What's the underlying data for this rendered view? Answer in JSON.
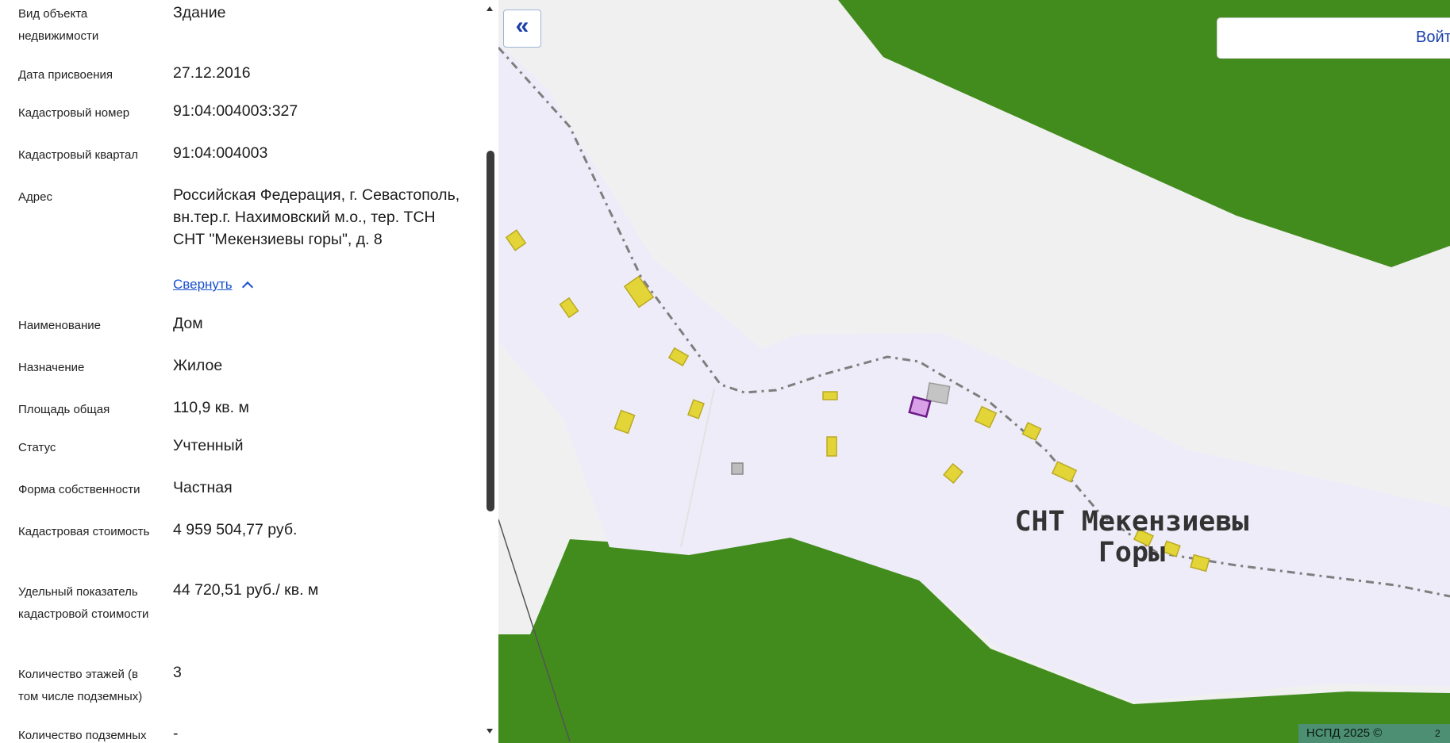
{
  "properties": [
    {
      "label": "Вид объекта недвижимости",
      "value": "Здание"
    },
    {
      "label": "Дата присвоения",
      "value": "27.12.2016"
    },
    {
      "label": "Кадастровый номер",
      "value": "91:04:004003:327"
    },
    {
      "label": "Кадастровый квартал",
      "value": "91:04:004003"
    },
    {
      "label": "Адрес",
      "value": "Российская Федерация, г. Севастополь, вн.тер.г. Нахимовский м.о., тер. ТСН СНТ \"Мекензиевы горы\", д. 8",
      "toggle_label": "Свернуть"
    },
    {
      "label": "Наименование",
      "value": "Дом"
    },
    {
      "label": "Назначение",
      "value": "Жилое"
    },
    {
      "label": "Площадь общая",
      "value": "110,9 кв. м"
    },
    {
      "label": "Статус",
      "value": "Учтенный"
    },
    {
      "label": "Форма собственности",
      "value": "Частная"
    },
    {
      "label": "Кадастровая стоимость",
      "value": "4 959 504,77 руб."
    },
    {
      "label": "Удельный показатель кадастровой стоимости",
      "value": "44 720,51 руб./ кв. м"
    },
    {
      "label": "Количество этажей (в том числе подземных)",
      "value": "3"
    },
    {
      "label": "Количество подземных",
      "value": "-"
    }
  ],
  "map": {
    "place_label_line1": "СНТ Мекензиевы",
    "place_label_line2": "Горы",
    "collapse_button": "«",
    "login_button": "Войти",
    "attribution": "НСПД 2025 ©",
    "scale_fragment": "2",
    "colors": {
      "forest": "#428c1d",
      "territory": "#efecf9",
      "background": "#f0f0f0",
      "building": "#e3d437",
      "selected": "#d9a0e8"
    }
  }
}
